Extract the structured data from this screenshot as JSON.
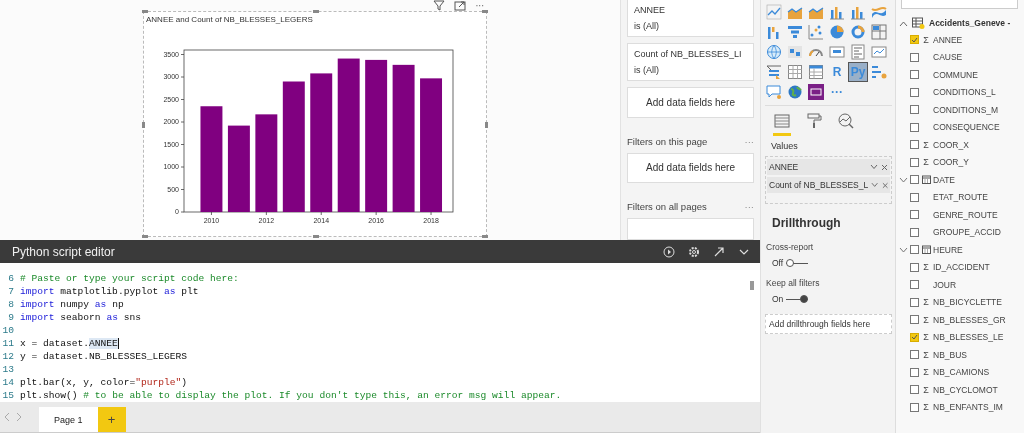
{
  "canvas": {
    "visual": {
      "title": "ANNEE and Count of NB_BLESSES_LEGERS",
      "chart_data": {
        "type": "bar",
        "x": [
          2010,
          2011,
          2012,
          2013,
          2014,
          2015,
          2016,
          2017,
          2018
        ],
        "series": [
          {
            "color": "#800080",
            "values": [
              2350,
              1920,
              2170,
              2900,
              3080,
              3410,
              3380,
              3270,
              2970
            ]
          }
        ],
        "xlim": [
          2009.0,
          2018.8
        ],
        "ylim": [
          0,
          3600
        ],
        "xticks": [
          2010,
          2012,
          2014,
          2016,
          2018
        ],
        "yticks": [
          0,
          500,
          1000,
          1500,
          2000,
          2500,
          3000,
          3500
        ]
      }
    },
    "visual_header_more": "···"
  },
  "filters": {
    "visual_filters": [
      {
        "field": "ANNEE",
        "condition": "is (All)"
      },
      {
        "field": "Count of NB_BLESSES_LI",
        "condition": "is (All)"
      }
    ],
    "visual_drop": "Add data fields here",
    "sections": [
      {
        "title": "Filters on this page",
        "more": "···",
        "drop": "Add data fields here"
      },
      {
        "title": "Filters on all pages",
        "more": "···"
      }
    ]
  },
  "editor": {
    "title": "Python script editor",
    "lines": [
      {
        "number": "6",
        "tokens": [
          {
            "kind": "comment",
            "text": "# Paste or type your script code here:"
          }
        ]
      },
      {
        "number": "7",
        "tokens": [
          {
            "kind": "keyword",
            "text": "import"
          },
          {
            "kind": "plain",
            "text": " matplotlib.pyplot "
          },
          {
            "kind": "keyword",
            "text": "as"
          },
          {
            "kind": "plain",
            "text": " plt"
          }
        ]
      },
      {
        "number": "8",
        "tokens": [
          {
            "kind": "keyword",
            "text": "import"
          },
          {
            "kind": "plain",
            "text": " numpy "
          },
          {
            "kind": "keyword",
            "text": "as"
          },
          {
            "kind": "plain",
            "text": " np"
          }
        ]
      },
      {
        "number": "9",
        "tokens": [
          {
            "kind": "keyword",
            "text": "import"
          },
          {
            "kind": "plain",
            "text": " seaborn "
          },
          {
            "kind": "keyword",
            "text": "as"
          },
          {
            "kind": "plain",
            "text": " sns"
          }
        ]
      },
      {
        "number": "10"
      },
      {
        "number": "11",
        "tokens": [
          {
            "kind": "plain",
            "text": "x = dataset."
          },
          {
            "kind": "highlight",
            "text": "ANNEE"
          }
        ]
      },
      {
        "number": "12",
        "tokens": [
          {
            "kind": "plain",
            "text": "y = dataset.NB_BLESSES_LEGERS"
          }
        ]
      },
      {
        "number": "13"
      },
      {
        "number": "14",
        "tokens": [
          {
            "kind": "plain",
            "text": "plt.bar(x, y, color="
          },
          {
            "kind": "string",
            "text": "\"purple\""
          },
          {
            "kind": "plain",
            "text": ")"
          }
        ]
      },
      {
        "number": "15",
        "tokens": [
          {
            "kind": "plain",
            "text": "plt.show() "
          },
          {
            "kind": "comment",
            "text": "# to be able to display the plot. If you don't type this, an error msg will appear."
          }
        ]
      }
    ]
  },
  "pages": {
    "tabs": [
      {
        "label": "Page 1",
        "selected": true
      }
    ],
    "add": "+"
  },
  "visualizations": {
    "types": [
      {
        "kind": "line",
        "selected": false
      },
      {
        "kind": "area",
        "selected": false
      },
      {
        "kind": "area",
        "selected": false
      },
      {
        "kind": "column",
        "selected": false
      },
      {
        "kind": "column",
        "selected": false
      },
      {
        "kind": "ribbon",
        "selected": false
      },
      {
        "kind": "waterfall",
        "selected": false
      },
      {
        "kind": "funnel",
        "selected": false
      },
      {
        "kind": "scatter",
        "selected": false
      },
      {
        "kind": "pie",
        "selected": false
      },
      {
        "kind": "donut",
        "selected": false
      },
      {
        "kind": "treemap",
        "selected": false
      },
      {
        "kind": "map",
        "selected": false
      },
      {
        "kind": "filled-map",
        "selected": false
      },
      {
        "kind": "gauge",
        "selected": false
      },
      {
        "kind": "card",
        "selected": false
      },
      {
        "kind": "multirow-card",
        "selected": false
      },
      {
        "kind": "kpi",
        "selected": false
      },
      {
        "kind": "slicer",
        "selected": false
      },
      {
        "kind": "table",
        "selected": false
      },
      {
        "kind": "matrix",
        "selected": false
      },
      {
        "kind": "text",
        "label": "R",
        "selected": false
      },
      {
        "kind": "text",
        "label": "Py",
        "selected": true
      },
      {
        "kind": "influencers",
        "selected": false
      },
      {
        "kind": "qa",
        "selected": false
      },
      {
        "kind": "globe",
        "selected": false
      },
      {
        "kind": "custom",
        "selected": false
      },
      {
        "kind": "text",
        "label": "···",
        "selected": false
      }
    ],
    "pane_tabs": [
      {
        "kind": "fields",
        "selected": true
      },
      {
        "kind": "format",
        "selected": false
      },
      {
        "kind": "analytics",
        "selected": false
      }
    ],
    "values_label": "Values",
    "wells": [
      {
        "label": "ANNEE"
      },
      {
        "label": "Count of NB_BLESSES_L"
      }
    ],
    "drillthrough": {
      "title": "Drillthrough",
      "toggles": [
        {
          "label": "Cross-report",
          "state": "Off",
          "on": false
        },
        {
          "label": "Keep all filters",
          "state": "On",
          "on": true
        }
      ],
      "drop": "Add drillthrough fields here"
    }
  },
  "fields": {
    "table": {
      "name": "Accidents_Geneve -",
      "expanded": true,
      "items": [
        {
          "kind": "field",
          "name": "ANNEE",
          "marker": "Σ",
          "checked": true
        },
        {
          "kind": "field",
          "name": "CAUSE",
          "checked": false
        },
        {
          "kind": "field",
          "name": "COMMUNE",
          "checked": false
        },
        {
          "kind": "field",
          "name": "CONDITIONS_L",
          "checked": false
        },
        {
          "kind": "field",
          "name": "CONDITIONS_M",
          "checked": false
        },
        {
          "kind": "field",
          "name": "CONSEQUENCE",
          "checked": false
        },
        {
          "kind": "field",
          "name": "COOR_X",
          "marker": "Σ",
          "checked": false
        },
        {
          "kind": "field",
          "name": "COOR_Y",
          "marker": "Σ",
          "checked": false
        },
        {
          "kind": "hierarchy",
          "name": "DATE",
          "checked": false,
          "expanded": false
        },
        {
          "kind": "field",
          "name": "ETAT_ROUTE",
          "checked": false
        },
        {
          "kind": "field",
          "name": "GENRE_ROUTE",
          "checked": false
        },
        {
          "kind": "field",
          "name": "GROUPE_ACCID",
          "checked": false
        },
        {
          "kind": "hierarchy",
          "name": "HEURE",
          "checked": false,
          "expanded": false
        },
        {
          "kind": "field",
          "name": "ID_ACCIDENT",
          "marker": "Σ",
          "checked": false
        },
        {
          "kind": "field",
          "name": "JOUR",
          "checked": false
        },
        {
          "kind": "field",
          "name": "NB_BICYCLETTE",
          "marker": "Σ",
          "checked": false
        },
        {
          "kind": "field",
          "name": "NB_BLESSES_GR",
          "marker": "Σ",
          "checked": false
        },
        {
          "kind": "field",
          "name": "NB_BLESSES_LE",
          "marker": "Σ",
          "checked": true
        },
        {
          "kind": "field",
          "name": "NB_BUS",
          "marker": "Σ",
          "checked": false
        },
        {
          "kind": "field",
          "name": "NB_CAMIONS",
          "marker": "Σ",
          "checked": false
        },
        {
          "kind": "field",
          "name": "NB_CYCLOMOT",
          "marker": "Σ",
          "checked": false
        },
        {
          "kind": "field",
          "name": "NB_ENFANTS_IM",
          "marker": "Σ",
          "checked": false
        }
      ]
    }
  }
}
